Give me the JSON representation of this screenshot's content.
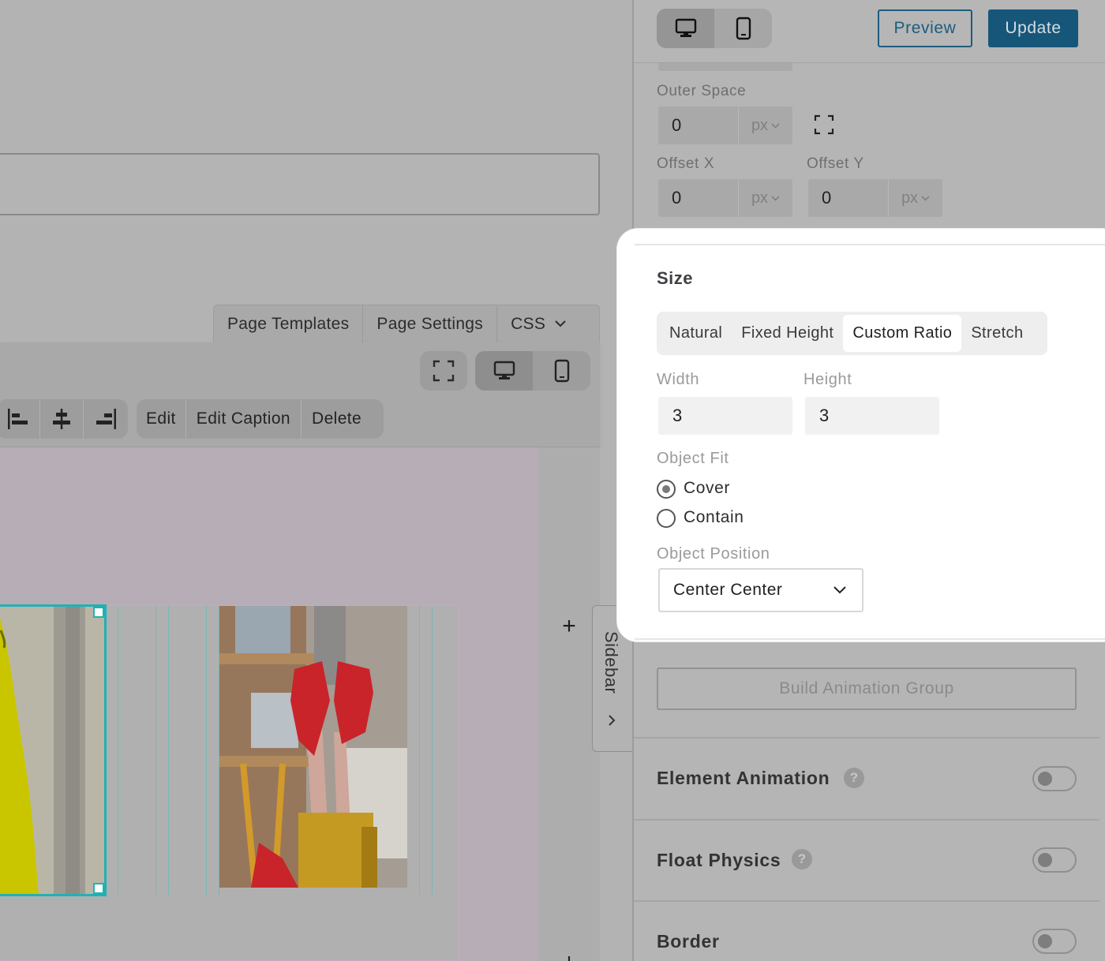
{
  "editor": {
    "template_tabs": [
      {
        "label": "Page Templates"
      },
      {
        "label": "Page Settings"
      },
      {
        "label": "CSS"
      }
    ],
    "block_toolbar": {
      "edit_label": "Edit",
      "edit_caption_label": "Edit Caption",
      "delete_label": "Delete"
    },
    "sidebar_tab_label": "Sidebar",
    "plus_glyph": "+"
  },
  "header": {
    "preview_label": "Preview",
    "update_label": "Update",
    "device_modes": [
      "desktop-icon",
      "mobile-icon"
    ],
    "active_device": "desktop"
  },
  "spacing": {
    "outer_space_label": "Outer Space",
    "outer_space_value": "0",
    "outer_space_unit": "px",
    "offset_x_label": "Offset X",
    "offset_x_value": "0",
    "offset_x_unit": "px",
    "offset_y_label": "Offset Y",
    "offset_y_value": "0",
    "offset_y_unit": "px"
  },
  "size": {
    "title": "Size",
    "modes": [
      "Natural",
      "Fixed Height",
      "Custom Ratio",
      "Stretch"
    ],
    "active_mode": "Custom Ratio",
    "width_label": "Width",
    "width_value": "3",
    "height_label": "Height",
    "height_value": "3",
    "object_fit_label": "Object Fit",
    "object_fit_options": [
      "Cover",
      "Contain"
    ],
    "object_fit_selected": "Cover",
    "object_position_label": "Object Position",
    "object_position_value": "Center Center"
  },
  "animation": {
    "build_group_label": "Build Animation Group"
  },
  "sections": [
    {
      "title": "Element Animation",
      "help": "?",
      "enabled": false
    },
    {
      "title": "Float Physics",
      "help": "?",
      "enabled": false
    },
    {
      "title": "Border",
      "enabled": false
    }
  ],
  "colors": {
    "accent": "#165779",
    "selection_outline": "#1fb2b4",
    "overlay_gray": "#b3b3b3",
    "card_white": "#ffffff"
  }
}
